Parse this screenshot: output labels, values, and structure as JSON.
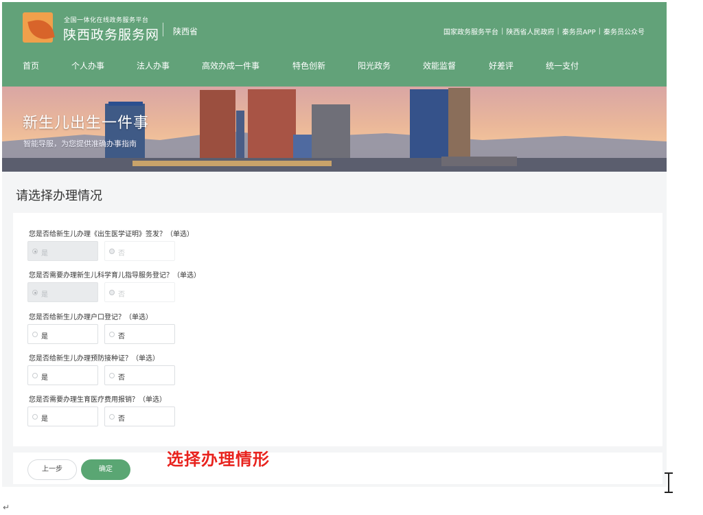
{
  "header": {
    "platform_sub": "全国一体化在线政务服务平台",
    "site_title": "陕西政务服务网",
    "province": "陕西省",
    "top_links": [
      "国家政务服务平台",
      "陕西省人民政府",
      "秦务员APP",
      "秦务员公众号"
    ]
  },
  "nav": {
    "items": [
      "首页",
      "个人办事",
      "法人办事",
      "高效办成一件事",
      "特色创新",
      "阳光政务",
      "效能监督",
      "好差评",
      "统一支付"
    ]
  },
  "banner": {
    "title": "新生儿出生一件事",
    "subtitle": "智能导服，为您提供准确办事指南"
  },
  "section": {
    "title": "请选择办理情况"
  },
  "questions": [
    {
      "label": "您是否给新生儿办理《出生医学证明》签发？（单选）",
      "yes": "是",
      "no": "否"
    },
    {
      "label": "您是否需要办理新生儿科学育儿指导服务登记？（单选）",
      "yes": "是",
      "no": "否"
    },
    {
      "label": "您是否给新生儿办理户口登记？（单选）",
      "yes": "是",
      "no": "否"
    },
    {
      "label": "您是否给新生儿办理预防接种证？（单选）",
      "yes": "是",
      "no": "否"
    },
    {
      "label": "您是否需要办理生育医疗费用报销？（单选）",
      "yes": "是",
      "no": "否"
    }
  ],
  "actions": {
    "prev": "上一步",
    "confirm": "确定"
  },
  "annotation": "选择办理情形",
  "colors": {
    "header_green": "#62a279",
    "confirm_green": "#5aa673",
    "annotation_red": "#e8231e"
  },
  "misc": {
    "paragraph_mark": "↵"
  }
}
